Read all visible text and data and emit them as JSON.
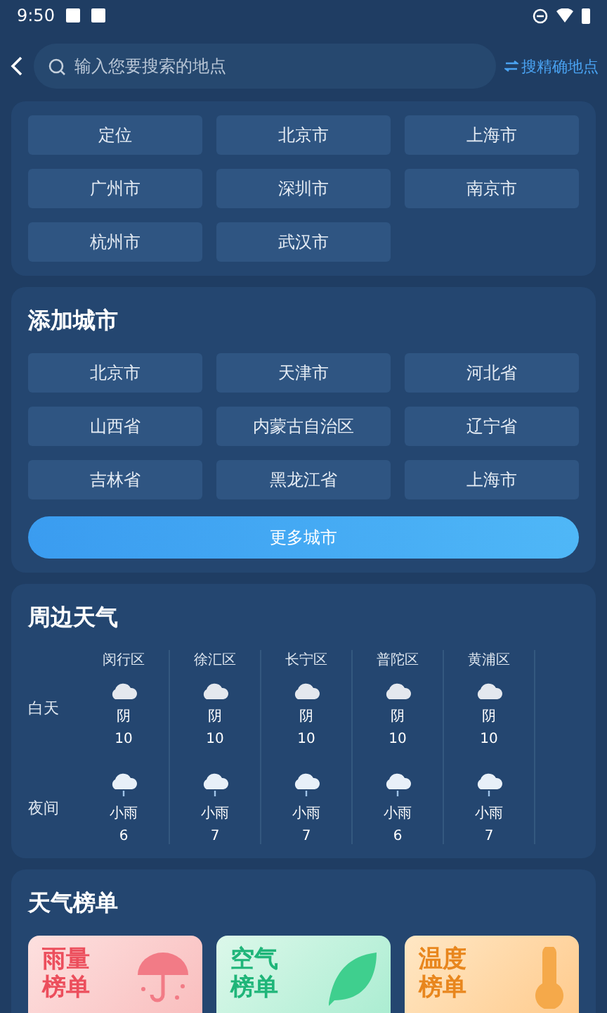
{
  "status_bar": {
    "time": "9:50"
  },
  "search": {
    "placeholder": "输入您要搜索的地点",
    "precise_link": "搜精确地点"
  },
  "location_cities": [
    "定位",
    "北京市",
    "上海市",
    "广州市",
    "深圳市",
    "南京市",
    "杭州市",
    "武汉市"
  ],
  "add_city": {
    "title": "添加城市",
    "cities": [
      "北京市",
      "天津市",
      "河北省",
      "山西省",
      "内蒙古自治区",
      "辽宁省",
      "吉林省",
      "黑龙江省",
      "上海市"
    ],
    "more_button": "更多城市"
  },
  "nearby": {
    "title": "周边天气",
    "row_labels": [
      "白天",
      "夜间"
    ],
    "districts": [
      {
        "name": "闵行区",
        "day": {
          "kind": "cloudy",
          "condition": "阴",
          "temp": "10"
        },
        "night": {
          "kind": "rain",
          "condition": "小雨",
          "temp": "6"
        }
      },
      {
        "name": "徐汇区",
        "day": {
          "kind": "cloudy",
          "condition": "阴",
          "temp": "10"
        },
        "night": {
          "kind": "rain",
          "condition": "小雨",
          "temp": "7"
        }
      },
      {
        "name": "长宁区",
        "day": {
          "kind": "cloudy",
          "condition": "阴",
          "temp": "10"
        },
        "night": {
          "kind": "rain",
          "condition": "小雨",
          "temp": "7"
        }
      },
      {
        "name": "普陀区",
        "day": {
          "kind": "cloudy",
          "condition": "阴",
          "temp": "10"
        },
        "night": {
          "kind": "rain",
          "condition": "小雨",
          "temp": "6"
        }
      },
      {
        "name": "黄浦区",
        "day": {
          "kind": "cloudy",
          "condition": "阴",
          "temp": "10"
        },
        "night": {
          "kind": "rain",
          "condition": "小雨",
          "temp": "7"
        }
      }
    ]
  },
  "rankings": {
    "title": "天气榜单",
    "cards": [
      {
        "kind": "rain",
        "lines": [
          "雨量",
          "榜单"
        ]
      },
      {
        "kind": "air",
        "lines": [
          "空气",
          "榜单"
        ]
      },
      {
        "kind": "temperature",
        "lines": [
          "温度",
          "榜单"
        ]
      }
    ]
  }
}
